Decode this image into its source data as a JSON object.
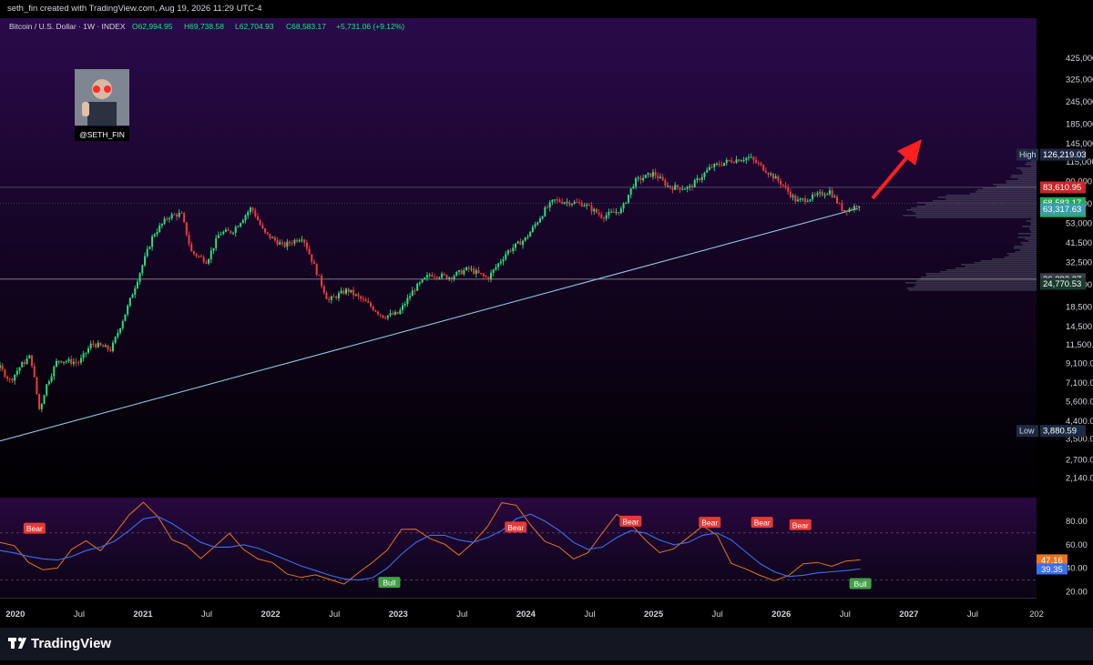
{
  "header": {
    "credit": "seth_fin created with TradingView.com, Aug 19, 2026 11:29 UTC-4"
  },
  "legend": {
    "symbol": "Bitcoin / U.S. Dollar · 1W · INDEX",
    "open": "O62,994.95",
    "high": "H69,738.58",
    "low": "L62,704.93",
    "close": "C68,583.17",
    "change": "+5,731.06 (+9.12%)"
  },
  "avatar": {
    "handle": "@SETH_FIN"
  },
  "branding": {
    "name": "TradingView"
  },
  "colors": {
    "up": "#26e07a",
    "down": "#ef3b3b",
    "trendline": "#8fc6e0",
    "arrow": "#ff1f1f",
    "rsi": "#e8741d",
    "rsi_ma": "#3a6ff0",
    "bg_top": "#2a0a4a",
    "bg_bottom": "#000000"
  },
  "chart_data": [
    {
      "type": "candlestick",
      "title": "Bitcoin / U.S. Dollar · 1W · INDEX",
      "yscale": "log",
      "ylim": [
        1900,
        500000
      ],
      "xlim": [
        2019.88,
        2028.0
      ],
      "y_ticks": [
        425000,
        325000,
        245000,
        185000,
        145000,
        115000,
        90000,
        68000,
        53000,
        41500,
        32500,
        24500,
        18500,
        14500,
        11500,
        9100,
        7100,
        5600,
        4400,
        3500,
        2700,
        2140
      ],
      "y_tick_labels": [
        "425,000.00",
        "325,000.00",
        "245,000.00",
        "185,000.00",
        "145,000.00",
        "115,000.00",
        "90,000.00",
        "68,000.00",
        "53,000.00",
        "41,500.00",
        "32,500.00",
        "24,500.00",
        "18,500.00",
        "14,500.00",
        "11,500.00",
        "9,100.00",
        "7,100.00",
        "5,600.00",
        "4,400.00",
        "3,500.00",
        "2,700.00",
        "2,140.00"
      ],
      "x_ticks": [
        {
          "t": 2020.0,
          "label": "2020"
        },
        {
          "t": 2020.5,
          "label": "Jul"
        },
        {
          "t": 2021.0,
          "label": "2021"
        },
        {
          "t": 2021.5,
          "label": "Jul"
        },
        {
          "t": 2022.0,
          "label": "2022"
        },
        {
          "t": 2022.5,
          "label": "Jul"
        },
        {
          "t": 2023.0,
          "label": "2023"
        },
        {
          "t": 2023.5,
          "label": "Jul"
        },
        {
          "t": 2024.0,
          "label": "2024"
        },
        {
          "t": 2024.5,
          "label": "Jul"
        },
        {
          "t": 2025.0,
          "label": "2025"
        },
        {
          "t": 2025.5,
          "label": "Jul"
        },
        {
          "t": 2026.0,
          "label": "2026"
        },
        {
          "t": 2026.5,
          "label": "Jul"
        },
        {
          "t": 2027.0,
          "label": "2027"
        },
        {
          "t": 2027.5,
          "label": "Jul"
        },
        {
          "t": 2028.0,
          "label": "202"
        }
      ],
      "price_path": [
        [
          2019.88,
          8600
        ],
        [
          2019.96,
          7300
        ],
        [
          2020.04,
          8800
        ],
        [
          2020.12,
          10000
        ],
        [
          2020.19,
          5000
        ],
        [
          2020.24,
          6800
        ],
        [
          2020.33,
          9500
        ],
        [
          2020.5,
          9200
        ],
        [
          2020.6,
          11700
        ],
        [
          2020.75,
          10800
        ],
        [
          2020.88,
          18500
        ],
        [
          2021.0,
          32000
        ],
        [
          2021.08,
          46000
        ],
        [
          2021.2,
          58000
        ],
        [
          2021.3,
          60000
        ],
        [
          2021.38,
          37000
        ],
        [
          2021.5,
          33000
        ],
        [
          2021.6,
          47000
        ],
        [
          2021.7,
          48000
        ],
        [
          2021.85,
          65000
        ],
        [
          2021.95,
          47000
        ],
        [
          2022.1,
          40000
        ],
        [
          2022.25,
          45000
        ],
        [
          2022.35,
          30000
        ],
        [
          2022.45,
          20000
        ],
        [
          2022.6,
          23000
        ],
        [
          2022.75,
          19500
        ],
        [
          2022.88,
          16500
        ],
        [
          2023.0,
          17000
        ],
        [
          2023.12,
          23000
        ],
        [
          2023.25,
          28000
        ],
        [
          2023.4,
          27000
        ],
        [
          2023.55,
          30000
        ],
        [
          2023.7,
          26500
        ],
        [
          2023.85,
          37000
        ],
        [
          2024.0,
          44000
        ],
        [
          2024.15,
          63000
        ],
        [
          2024.22,
          71000
        ],
        [
          2024.45,
          68000
        ],
        [
          2024.6,
          58000
        ],
        [
          2024.75,
          63000
        ],
        [
          2024.85,
          90000
        ],
        [
          2025.0,
          100000
        ],
        [
          2025.12,
          84000
        ],
        [
          2025.28,
          83000
        ],
        [
          2025.45,
          108000
        ],
        [
          2025.6,
          117000
        ],
        [
          2025.75,
          122000
        ],
        [
          2025.85,
          108000
        ],
        [
          2026.0,
          88000
        ],
        [
          2026.12,
          70000
        ],
        [
          2026.25,
          74000
        ],
        [
          2026.38,
          80000
        ],
        [
          2026.48,
          63000
        ],
        [
          2026.55,
          64000
        ],
        [
          2026.62,
          68583
        ]
      ],
      "price_labels": [
        {
          "kind": "tag",
          "value": "High",
          "price": 126219.03,
          "label": "126,219.03",
          "color": "#1e2a44"
        },
        {
          "kind": "value",
          "price": 83610.95,
          "label": "83,610.95",
          "color": "#c62828"
        },
        {
          "kind": "value",
          "price": 68583.17,
          "label": "68,583.17",
          "sub": "4d 9h",
          "color": "#26a65b"
        },
        {
          "kind": "value",
          "price": 63317.63,
          "label": "63,317.63",
          "color": "#3a9ea8"
        },
        {
          "kind": "value",
          "price": 26292.27,
          "label": "26,292.27",
          "color": "#3a3f4a"
        },
        {
          "kind": "value",
          "price": 24770.53,
          "label": "24,770.53",
          "color": "#1b3a2e"
        },
        {
          "kind": "tag",
          "value": "Low",
          "price": 3880.59,
          "label": "3,880.59",
          "color": "#1e2a44"
        }
      ],
      "horizontal_levels": [
        83610.95,
        68583.17,
        26292.27
      ],
      "trendline": [
        [
          2019.88,
          3420
        ],
        [
          2026.6,
          64000
        ]
      ]
    },
    {
      "type": "line",
      "title": "RSI",
      "ylim": [
        15,
        100
      ],
      "y_ticks": [
        80,
        60,
        40,
        20
      ],
      "y_tick_labels": [
        "80.00",
        "60.00",
        "40.00",
        "20.00"
      ],
      "reference_levels": [
        70,
        30
      ],
      "series": [
        {
          "values": [
            62,
            55,
            48,
            38,
            43,
            60,
            66,
            58,
            72,
            88,
            98,
            80,
            60,
            55,
            46,
            55,
            68,
            60,
            48,
            42,
            38,
            36,
            32,
            29,
            30,
            32,
            42,
            60,
            70,
            76,
            68,
            58,
            55,
            66,
            78,
            92,
            98,
            76,
            66,
            58,
            50,
            56,
            66,
            84,
            78,
            62,
            55,
            58,
            68,
            76,
            70,
            48,
            38,
            32,
            30,
            36,
            48,
            42,
            40,
            45,
            47.16
          ]
        },
        {
          "values": [
            55,
            53,
            50,
            48,
            47,
            50,
            55,
            58,
            63,
            72,
            82,
            84,
            78,
            70,
            62,
            58,
            58,
            60,
            57,
            52,
            47,
            42,
            38,
            34,
            31,
            30,
            32,
            40,
            52,
            62,
            68,
            68,
            64,
            62,
            66,
            72,
            82,
            86,
            80,
            72,
            62,
            56,
            58,
            66,
            72,
            70,
            64,
            60,
            62,
            68,
            70,
            64,
            54,
            44,
            37,
            33,
            34,
            36,
            37,
            38,
            39.35
          ]
        }
      ],
      "value_labels": [
        {
          "value": 47.16,
          "label": "47.16",
          "color": "#e8741d"
        },
        {
          "value": 39.35,
          "label": "39.35",
          "color": "#3a6ff0"
        }
      ],
      "signals": [
        {
          "t": 2020.15,
          "value": 74,
          "label": "Bear",
          "kind": "bear"
        },
        {
          "t": 2022.93,
          "value": 28,
          "label": "Bull",
          "kind": "bull"
        },
        {
          "t": 2023.92,
          "value": 75,
          "label": "Bear",
          "kind": "bear"
        },
        {
          "t": 2024.82,
          "value": 80,
          "label": "Bear",
          "kind": "bear"
        },
        {
          "t": 2025.44,
          "value": 79,
          "label": "Bear",
          "kind": "bear"
        },
        {
          "t": 2025.85,
          "value": 79,
          "label": "Bear",
          "kind": "bear"
        },
        {
          "t": 2026.15,
          "value": 77,
          "label": "Bear",
          "kind": "bear"
        },
        {
          "t": 2026.62,
          "value": 27,
          "label": "Bull",
          "kind": "bull"
        }
      ]
    }
  ]
}
